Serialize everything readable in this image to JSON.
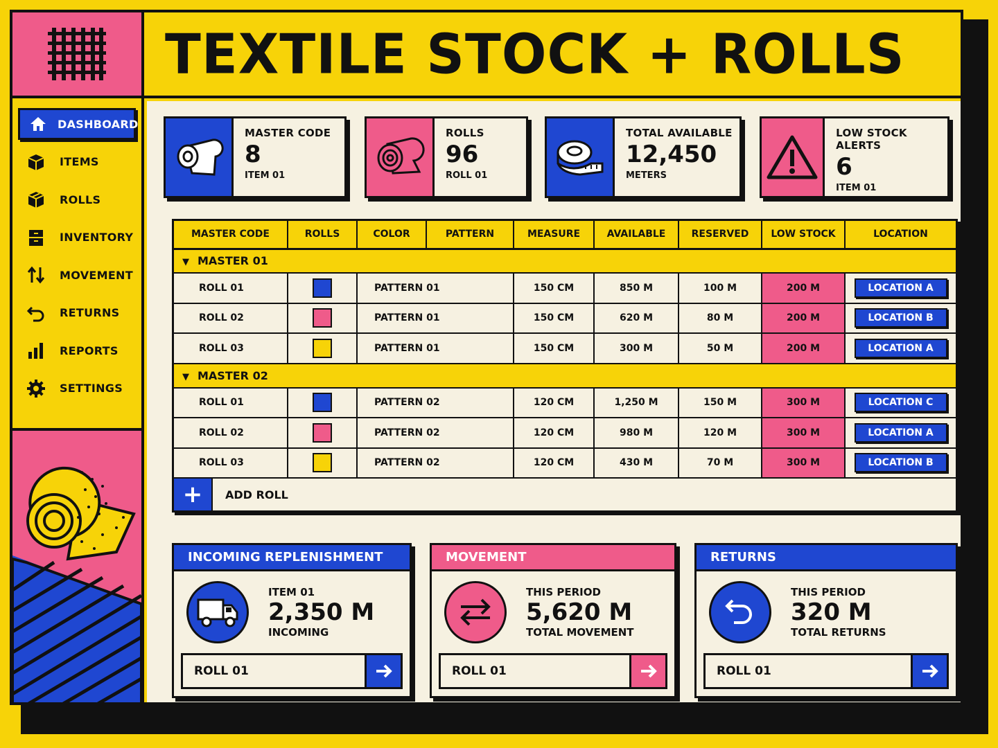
{
  "app": {
    "title": "TEXTILE STOCK + ROLLS"
  },
  "sidebar": {
    "items": [
      {
        "label": "DASHBOARD",
        "icon": "home-icon",
        "active": true
      },
      {
        "label": "ITEMS",
        "icon": "box-icon"
      },
      {
        "label": "ROLLS",
        "icon": "cube-icon"
      },
      {
        "label": "INVENTORY",
        "icon": "cabinet-icon"
      },
      {
        "label": "MOVEMENT",
        "icon": "swap-vertical-icon"
      },
      {
        "label": "RETURNS",
        "icon": "return-icon"
      },
      {
        "label": "REPORTS",
        "icon": "bar-chart-icon"
      },
      {
        "label": "SETTINGS",
        "icon": "gear-icon"
      }
    ]
  },
  "stats": [
    {
      "label": "MASTER CODE",
      "value": "8",
      "sub": "ITEM 01",
      "icon": "fabric-roll-icon",
      "color": "#1f47d1"
    },
    {
      "label": "ROLLS",
      "value": "96",
      "sub": "ROLL 01",
      "icon": "roll-icon",
      "color": "#ef5b8a"
    },
    {
      "label": "TOTAL AVAILABLE",
      "value": "12,450",
      "sub": "METERS",
      "icon": "tape-measure-icon",
      "color": "#1f47d1"
    },
    {
      "label": "LOW STOCK ALERTS",
      "value": "6",
      "sub": "ITEM 01",
      "icon": "warning-icon",
      "color": "#ef5b8a"
    }
  ],
  "table": {
    "headers": [
      "MASTER CODE",
      "ROLLS",
      "COLOR",
      "PATTERN",
      "MEASURE",
      "AVAILABLE",
      "RESERVED",
      "LOW STOCK",
      "LOCATION"
    ],
    "groups": [
      {
        "name": "MASTER 01",
        "rows": [
          {
            "roll": "ROLL 01",
            "color": "#1f47d1",
            "pattern": "PATTERN 01",
            "measure": "150 CM",
            "available": "850 M",
            "reserved": "100 M",
            "low": "200 M",
            "location": "LOCATION A"
          },
          {
            "roll": "ROLL 02",
            "color": "#ef5b8a",
            "pattern": "PATTERN 01",
            "measure": "150 CM",
            "available": "620 M",
            "reserved": "80 M",
            "low": "200 M",
            "location": "LOCATION B"
          },
          {
            "roll": "ROLL 03",
            "color": "#f7d308",
            "pattern": "PATTERN 01",
            "measure": "150 CM",
            "available": "300 M",
            "reserved": "50 M",
            "low": "200 M",
            "location": "LOCATION A"
          }
        ]
      },
      {
        "name": "MASTER 02",
        "rows": [
          {
            "roll": "ROLL 01",
            "color": "#1f47d1",
            "pattern": "PATTERN 02",
            "measure": "120 CM",
            "available": "1,250 M",
            "reserved": "150 M",
            "low": "300 M",
            "location": "LOCATION C"
          },
          {
            "roll": "ROLL 02",
            "color": "#ef5b8a",
            "pattern": "PATTERN 02",
            "measure": "120 CM",
            "available": "980 M",
            "reserved": "120 M",
            "low": "300 M",
            "location": "LOCATION A"
          },
          {
            "roll": "ROLL 03",
            "color": "#f7d308",
            "pattern": "PATTERN 02",
            "measure": "120 CM",
            "available": "430 M",
            "reserved": "70 M",
            "low": "300 M",
            "location": "LOCATION B"
          }
        ]
      }
    ],
    "add_label": "ADD ROLL"
  },
  "panels": [
    {
      "title": "INCOMING REPLENISHMENT",
      "label": "ITEM 01",
      "value": "2,350 M",
      "sub": "INCOMING",
      "foot": "ROLL 01",
      "icon": "truck-icon",
      "color": "#1f47d1"
    },
    {
      "title": "MOVEMENT",
      "label": "THIS PERIOD",
      "value": "5,620 M",
      "sub": "TOTAL MOVEMENT",
      "foot": "ROLL 01",
      "icon": "swap-icon",
      "color": "#ef5b8a"
    },
    {
      "title": "RETURNS",
      "label": "THIS PERIOD",
      "value": "320 M",
      "sub": "TOTAL RETURNS",
      "foot": "ROLL 01",
      "icon": "undo-icon",
      "color": "#1f47d1"
    }
  ],
  "colors": {
    "yellow": "#f7d308",
    "blue": "#1f47d1",
    "pink": "#ef5b8a",
    "cream": "#f6f1e1"
  }
}
